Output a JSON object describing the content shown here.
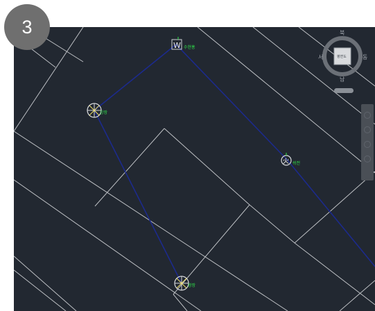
{
  "badge": {
    "step": "3"
  },
  "viewcube": {
    "north": "북",
    "south": "남",
    "east": "동",
    "west": "서",
    "face": "평면도"
  },
  "markers": [
    {
      "id": "fire-hydrant",
      "label": "수현홍"
    },
    {
      "id": "wellhead-left",
      "label": "강장"
    },
    {
      "id": "hydrant-right",
      "label": "쉬전"
    },
    {
      "id": "wellhead-bottom",
      "label": "광장"
    }
  ],
  "colors": {
    "background": "#222831",
    "parcel_lines": "#d8dadd",
    "route_line": "#1c2a8c",
    "marker_label": "#2fe34a"
  },
  "icons": [
    "compass-icon",
    "wellhead-icon",
    "hydrant-icon",
    "valve-icon"
  ]
}
